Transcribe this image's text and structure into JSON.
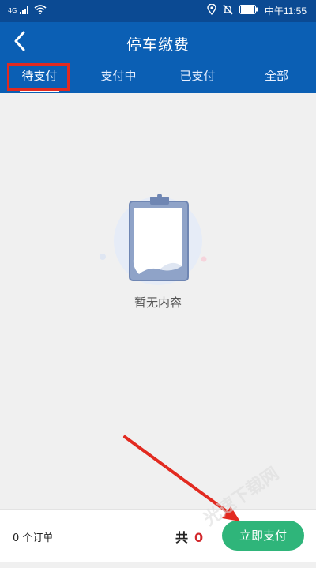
{
  "status_bar": {
    "network": "4G",
    "time": "中午11:55",
    "icons": [
      "signal-icon",
      "wifi-icon",
      "location-icon",
      "mute-icon",
      "battery-icon"
    ]
  },
  "header": {
    "title": "停车缴费",
    "back_icon": "back-arrow-icon"
  },
  "tabs": [
    {
      "label": "待支付",
      "active": true
    },
    {
      "label": "支付中",
      "active": false
    },
    {
      "label": "已支付",
      "active": false
    },
    {
      "label": "全部",
      "active": false
    }
  ],
  "empty_state": {
    "icon": "clipboard-icon",
    "text": "暂无内容"
  },
  "footer": {
    "order_count_label": "0 个订单",
    "total_label": "共",
    "total_value": "0",
    "pay_button": "立即支付"
  },
  "watermark_text": "光速下载网",
  "colors": {
    "header_bg": "#0b5fb4",
    "status_bg": "#0b4a93",
    "pay_button": "#2fb57a",
    "total_value": "#d2282c",
    "annotation": "#e22a20"
  }
}
